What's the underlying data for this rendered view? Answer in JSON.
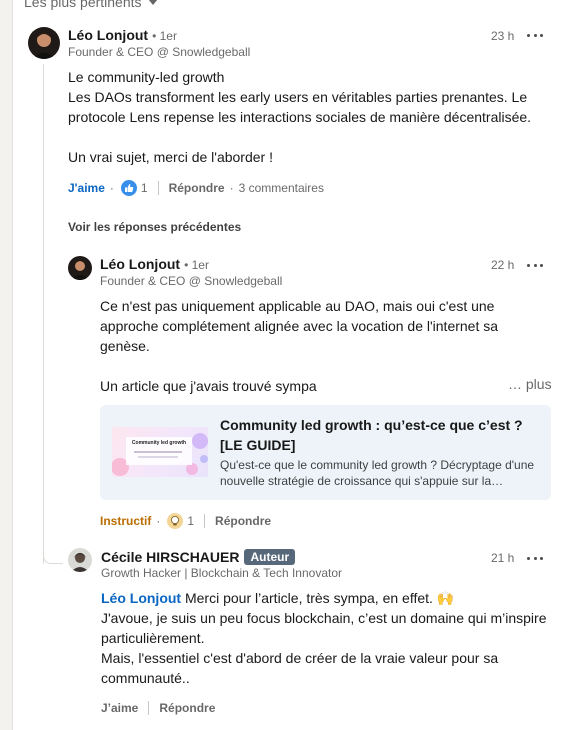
{
  "sort": {
    "label": "Les plus pertinents"
  },
  "comment1": {
    "author": "Léo Lonjout",
    "degree": "• 1er",
    "headline": "Founder & CEO @ Snowledgeball",
    "time": "23 h",
    "text_line1": "Le community-led growth",
    "text_line2": "Les DAOs transforment les early users en véritables parties prenantes. Le protocole Lens repense les interactions sociales de manière décentralisée.",
    "text_line3": "Un vrai sujet, merci de l'aborder !",
    "like_label": "J'aime",
    "reaction_count": "1",
    "reply_label": "Répondre",
    "comments_count": "3 commentaires",
    "reaction_icon": "like-thumb-icon"
  },
  "see_previous": "Voir les réponses précédentes",
  "reply1": {
    "author": "Léo Lonjout",
    "degree": "• 1er",
    "headline": "Founder & CEO @ Snowledgeball",
    "time": "22 h",
    "text_para1": "Ce n'est pas uniquement applicable au DAO, mais oui c'est une approche complétement alignée avec la vocation de l'internet sa genèse.",
    "text_para2": "Un article que j'avais trouvé sympa",
    "see_more": "… plus",
    "article": {
      "title": "Community led growth : qu’est-ce que c’est ? [LE GUIDE]",
      "description": "Qu'est-ce que le community led growth ? Décryptage d'une nouvelle stratégie de croissance qui s'appuie sur la…",
      "thumb_title": "Community led growth"
    },
    "reaction_label": "Instructif",
    "reaction_count": "1",
    "reply_label": "Répondre",
    "reaction_icon": "insightful-bulb-icon"
  },
  "reply2": {
    "author": "Cécile HIRSCHAUER",
    "badge": "Auteur",
    "headline": "Growth Hacker | Blockchain & Tech Innovator",
    "time": "21 h",
    "mention": "Léo Lonjout",
    "text_line1_rest": " Merci pour l’article, très sympa, en effet. 🙌",
    "text_line2": "J'avoue, je suis un peu focus blockchain, c’est un domaine qui m’inspire particulièrement.",
    "text_line3": "Mais, l'essentiel c'est d'abord de créer de la vraie valeur pour sa communauté..",
    "like_label": "J’aime",
    "reply_label": "Répondre"
  },
  "colors": {
    "link_blue": "#0a66c2",
    "insight_orange": "#b96d00",
    "author_badge": "#56687a",
    "article_bg": "#edf3f8"
  }
}
